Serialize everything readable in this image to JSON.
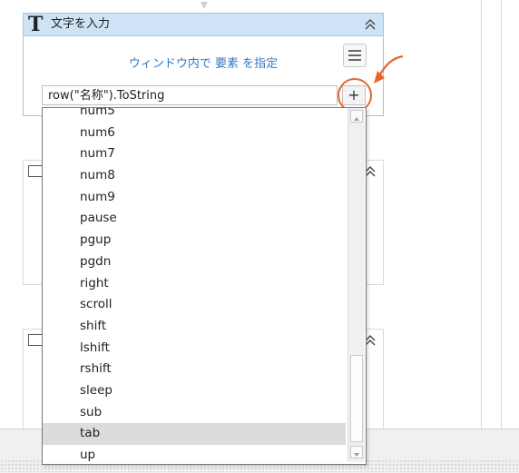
{
  "activity": {
    "title": "文字を入力",
    "indicate_link": "ウィンドウ内で 要素 を指定",
    "text_value": "row(\"名称\").ToString",
    "plus_label": "+"
  },
  "dropdown": {
    "items": [
      "num5",
      "num6",
      "num7",
      "num8",
      "num9",
      "pause",
      "pgup",
      "pgdn",
      "right",
      "scroll",
      "shift",
      "lshift",
      "rshift",
      "sleep",
      "sub",
      "tab",
      "up"
    ],
    "selected": "tab"
  },
  "colors": {
    "header_bg": "#cfe3f6",
    "link": "#2f7bc4",
    "annotation": "#e5652a"
  },
  "icons": {
    "collapse": "double-chevron-up-icon",
    "menu": "hamburger-icon",
    "scroll_up": "triangle-up-icon",
    "scroll_down": "triangle-down-icon"
  }
}
